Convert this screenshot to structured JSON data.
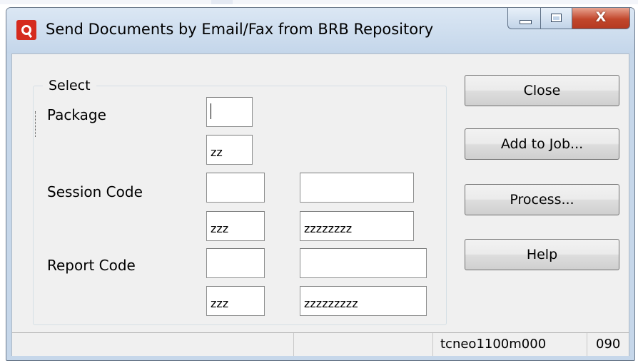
{
  "window": {
    "title": "Send Documents by Email/Fax from BRB Repository",
    "close_glyph": "X",
    "icons": {
      "app": "oracle-app-icon",
      "minimize": "minimize-icon",
      "maximize": "maximize-icon",
      "close": "close-icon"
    }
  },
  "select_group": {
    "title": "Select",
    "package": {
      "label": "Package",
      "from": "",
      "to": "zz"
    },
    "session_code": {
      "label": "Session Code",
      "from_a": "",
      "from_b": "",
      "to_a": "zzz",
      "to_b": "zzzzzzzz"
    },
    "report_code": {
      "label": "Report Code",
      "from_a": "",
      "from_b": "",
      "to_a": "zzz",
      "to_b": "zzzzzzzzz"
    }
  },
  "buttons": {
    "close": "Close",
    "add_to_job": "Add to Job...",
    "process": "Process...",
    "help": "Help"
  },
  "statusbar": {
    "session_name": "tcneo1100m000",
    "company": "090"
  },
  "colors": {
    "titlebar": "#c4d6ea",
    "close_button": "#c2472c",
    "client_bg": "#f0f0f0"
  }
}
